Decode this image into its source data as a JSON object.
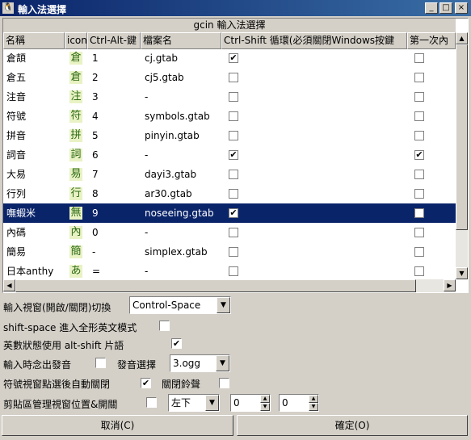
{
  "window": {
    "title": "輸入法選擇",
    "icon": "tux-icon",
    "minimize": "_",
    "maximize": "□",
    "close": "×"
  },
  "panel_title": "gcin 輸入法選擇",
  "columns": [
    "名稱",
    "icon",
    "Ctrl-Alt-鍵",
    "檔案名",
    "Ctrl-Shift 循環(必須關閉Windows按鍵",
    "第一次內"
  ],
  "rows": [
    {
      "name": "倉頡",
      "glyph": "倉",
      "key": "1",
      "file": "cj.gtab",
      "cycle": true,
      "first": false
    },
    {
      "name": "倉五",
      "glyph": "倉",
      "key": "2",
      "file": "cj5.gtab",
      "cycle": false,
      "first": false
    },
    {
      "name": "注音",
      "glyph": "注",
      "key": "3",
      "file": "-",
      "cycle": false,
      "first": false
    },
    {
      "name": "符號",
      "glyph": "符",
      "key": "4",
      "file": "symbols.gtab",
      "cycle": false,
      "first": false
    },
    {
      "name": "拼音",
      "glyph": "拼",
      "key": "5",
      "file": "pinyin.gtab",
      "cycle": false,
      "first": false
    },
    {
      "name": "詞音",
      "glyph": "詞",
      "key": "6",
      "file": "-",
      "cycle": true,
      "first": true
    },
    {
      "name": "大易",
      "glyph": "易",
      "key": "7",
      "file": "dayi3.gtab",
      "cycle": false,
      "first": false
    },
    {
      "name": "行列",
      "glyph": "行",
      "key": "8",
      "file": "ar30.gtab",
      "cycle": false,
      "first": false
    },
    {
      "name": "嘸蝦米",
      "glyph": "無",
      "key": "9",
      "file": "noseeing.gtab",
      "cycle": true,
      "first": false,
      "selected": true
    },
    {
      "name": "內碼",
      "glyph": "內",
      "key": "0",
      "file": "-",
      "cycle": false,
      "first": false
    },
    {
      "name": "簡易",
      "glyph": "簡",
      "key": "-",
      "file": "simplex.gtab",
      "cycle": false,
      "first": false
    },
    {
      "name": "日本anthy",
      "glyph": "あ",
      "key": "=",
      "file": "-",
      "cycle": false,
      "first": false
    }
  ],
  "options": {
    "toggle_label": "輸入視窗(開啟/關閉)切換",
    "toggle_value": "Control-Space",
    "shift_space_label": "shift-space 進入全形英文模式",
    "shift_space": false,
    "alnum_label": "英數狀態使用  alt-shift 片語",
    "alnum": true,
    "sound_label": "輸入時念出發音",
    "sound": false,
    "sound_select_label": "發音選擇",
    "sound_select_value": "3.ogg",
    "symbol_close_label": "符號視窗點選後自動關閉",
    "symbol_close": true,
    "bell_label": "關閉鈴聲",
    "bell": false,
    "clipboard_label": "剪貼區管理視窗位置&開關",
    "clipboard": false,
    "clipboard_pos": "左下",
    "clipboard_x": "0",
    "clipboard_y": "0"
  },
  "buttons": {
    "cancel": "取消(C)",
    "ok": "確定(O)"
  },
  "check_glyph": "✔"
}
